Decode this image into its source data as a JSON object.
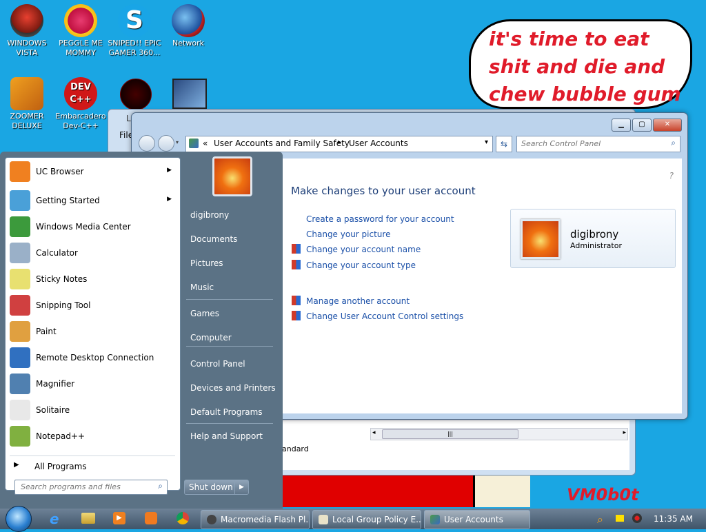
{
  "desktop": {
    "icons": [
      {
        "label": "WINDOWS VISTA"
      },
      {
        "label": "PEGGLE ME MOMMY"
      },
      {
        "label": "SNIPED!! EPIC GAMER 360..."
      },
      {
        "label": "Network"
      },
      {
        "label": "ZOOMER DELUXE"
      },
      {
        "label": "Embarcadero Dev-C++"
      }
    ],
    "graffiti_text": "it's time to eat shit and die and chew bubble gum",
    "signature": "VM0b0t"
  },
  "bg_window": {
    "menu_file": "File",
    "status_tab": "andard",
    "title_initial": "L"
  },
  "window": {
    "breadcrumb": {
      "prefix": "«",
      "crumb1": "User Accounts and Family Safety",
      "separator": "▸",
      "crumb2": "User Accounts"
    },
    "search_placeholder": "Search Control Panel",
    "heading": "Make changes to your user account",
    "links": [
      "Create a password for your account",
      "Change your picture",
      "Change your account name",
      "Change your account type",
      "Manage another account",
      "Change User Account Control settings"
    ],
    "user": {
      "name": "digibrony",
      "role": "Administrator"
    },
    "help_glyph": "?"
  },
  "start_menu": {
    "programs": [
      {
        "label": "UC Browser",
        "has_submenu": true,
        "icon": "uc-browser-icon",
        "color": "#f08020"
      },
      {
        "label": "Getting Started",
        "has_submenu": true,
        "icon": "getting-started-icon",
        "color": "#4aa0d8"
      },
      {
        "label": "Windows Media Center",
        "has_submenu": false,
        "icon": "media-center-icon",
        "color": "#3c9a3c"
      },
      {
        "label": "Calculator",
        "has_submenu": false,
        "icon": "calculator-icon",
        "color": "#9ab0c8"
      },
      {
        "label": "Sticky Notes",
        "has_submenu": false,
        "icon": "sticky-notes-icon",
        "color": "#e8e070"
      },
      {
        "label": "Snipping Tool",
        "has_submenu": false,
        "icon": "scissors-icon",
        "color": "#d04040"
      },
      {
        "label": "Paint",
        "has_submenu": false,
        "icon": "paint-palette-icon",
        "color": "#e0a040"
      },
      {
        "label": "Remote Desktop Connection",
        "has_submenu": false,
        "icon": "remote-desktop-icon",
        "color": "#3070c0"
      },
      {
        "label": "Magnifier",
        "has_submenu": false,
        "icon": "magnifier-icon",
        "color": "#5080b0"
      },
      {
        "label": "Solitaire",
        "has_submenu": false,
        "icon": "cards-icon",
        "color": "#e8e8e8"
      },
      {
        "label": "Notepad++",
        "has_submenu": false,
        "icon": "notepad-plus-icon",
        "color": "#80b040"
      }
    ],
    "all_programs": "All Programs",
    "search_placeholder": "Search programs and files",
    "right_items": [
      "digibrony",
      "Documents",
      "Pictures",
      "Music",
      "Games",
      "Computer",
      "Control Panel",
      "Devices and Printers",
      "Default Programs",
      "Help and Support"
    ],
    "shutdown": "Shut down"
  },
  "taskbar": {
    "tasks": [
      {
        "label": "Macromedia Flash Pl..."
      },
      {
        "label": "Local Group Policy E..."
      },
      {
        "label": "User Accounts"
      }
    ],
    "clock": "11:35 AM"
  }
}
